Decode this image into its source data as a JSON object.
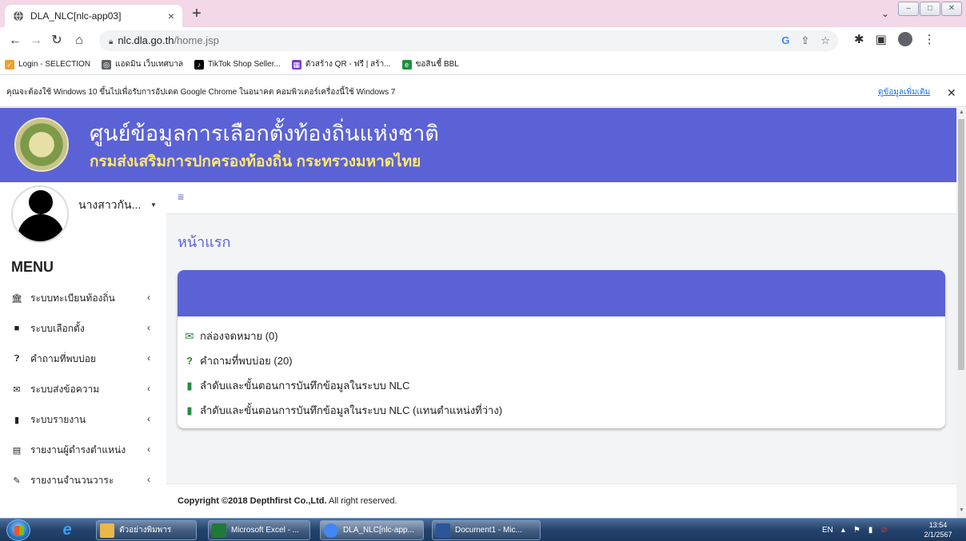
{
  "browser": {
    "tab_title": "DLA_NLC[nlc-app03]",
    "tab_close": "×",
    "new_tab": "+",
    "url_host": "nlc.dla.go.th",
    "url_path": "/home.jsp",
    "bookmarks": [
      {
        "label": "Login - SELECTION",
        "icon": "selection-icon",
        "color": "#f0a030"
      },
      {
        "label": "แอดมิน เว็บเทศบาล",
        "icon": "globe-icon",
        "color": "#5f6368"
      },
      {
        "label": "TikTok Shop Seller...",
        "icon": "tiktok-icon",
        "color": "#000000"
      },
      {
        "label": "ตัวสร้าง QR - ฟรี | สร้า...",
        "icon": "qr-icon",
        "color": "#7b3fc0"
      },
      {
        "label": "ขอสินชี้ BBL",
        "icon": "bbl-icon",
        "color": "#1e8e3e"
      }
    ]
  },
  "infobar": {
    "message": "คุณจะต้องใช้ Windows 10 ขึ้นไปเพื่อรับการอัปเดต Google Chrome ในอนาคต คอมพิวเตอร์เครื่องนี้ใช้ Windows 7",
    "more_link": "ดูข้อมูลเพิ่มเติม",
    "close": "✕"
  },
  "header": {
    "title": "ศูนย์ข้อมูลการเลือกตั้งท้องถิ่นแห่งชาติ",
    "subtitle": "กรมส่งเสริมการปกครองท้องถิ่น กระทรวงมหาดไทย",
    "color": "#5b62d6",
    "subtitle_color": "#ffe86b"
  },
  "user": {
    "name": "นางสาวกัน..."
  },
  "menu": {
    "title": "MENU",
    "items": [
      {
        "label": "ระบบทะเบียนท้องถิ่น",
        "icon": "bank-icon"
      },
      {
        "label": "ระบบเลือกตั้ง",
        "icon": "briefcase-icon"
      },
      {
        "label": "คำถามที่พบบ่อย",
        "icon": "question-circle-icon"
      },
      {
        "label": "ระบบส่งข้อความ",
        "icon": "envelope-icon"
      },
      {
        "label": "ระบบรายงาน",
        "icon": "file-icon"
      },
      {
        "label": "รายงานผู้ดำรงตำแหน่ง",
        "icon": "file-text-icon"
      },
      {
        "label": "รายงานจำนวนวาระ",
        "icon": "edit-icon"
      }
    ]
  },
  "main": {
    "page_title": "หน้าแรก",
    "links": [
      {
        "label": "กล่องจดหมาย (0)",
        "icon": "inbox-icon",
        "color": "#1e7b3a"
      },
      {
        "label": "คำถามที่พบบ่อย (20)",
        "icon": "question-icon",
        "color": "#2e8b2e"
      },
      {
        "label": "ลำดับและขั้นตอนการบันทึกข้อมูลในระบบ NLC",
        "icon": "book-icon",
        "color": "#1e8e3e"
      },
      {
        "label": "ลำดับและขั้นตอนการบันทึกข้อมูลในระบบ NLC (แทนตำแหน่งที่ว่าง)",
        "icon": "book-icon",
        "color": "#1e8e3e"
      }
    ]
  },
  "footer": {
    "copyright": "Copyright ©2018 Depthfirst Co.,Ltd.",
    "rights": " All right reserved."
  },
  "taskbar": {
    "items": [
      {
        "label": "ตัวอย่างพิมพาร",
        "icon": "folder-icon",
        "color": "#e8b84a"
      },
      {
        "label": "Microsoft Excel - ...",
        "icon": "excel-icon",
        "color": "#1f7a3a"
      },
      {
        "label": "DLA_NLC[nlc-app...",
        "icon": "chrome-icon",
        "color": "#4285f4"
      },
      {
        "label": "Document1 - Mic...",
        "icon": "word-icon",
        "color": "#2b579a"
      }
    ],
    "lang": "EN",
    "time": "13:54",
    "date": "2/1/2567"
  }
}
